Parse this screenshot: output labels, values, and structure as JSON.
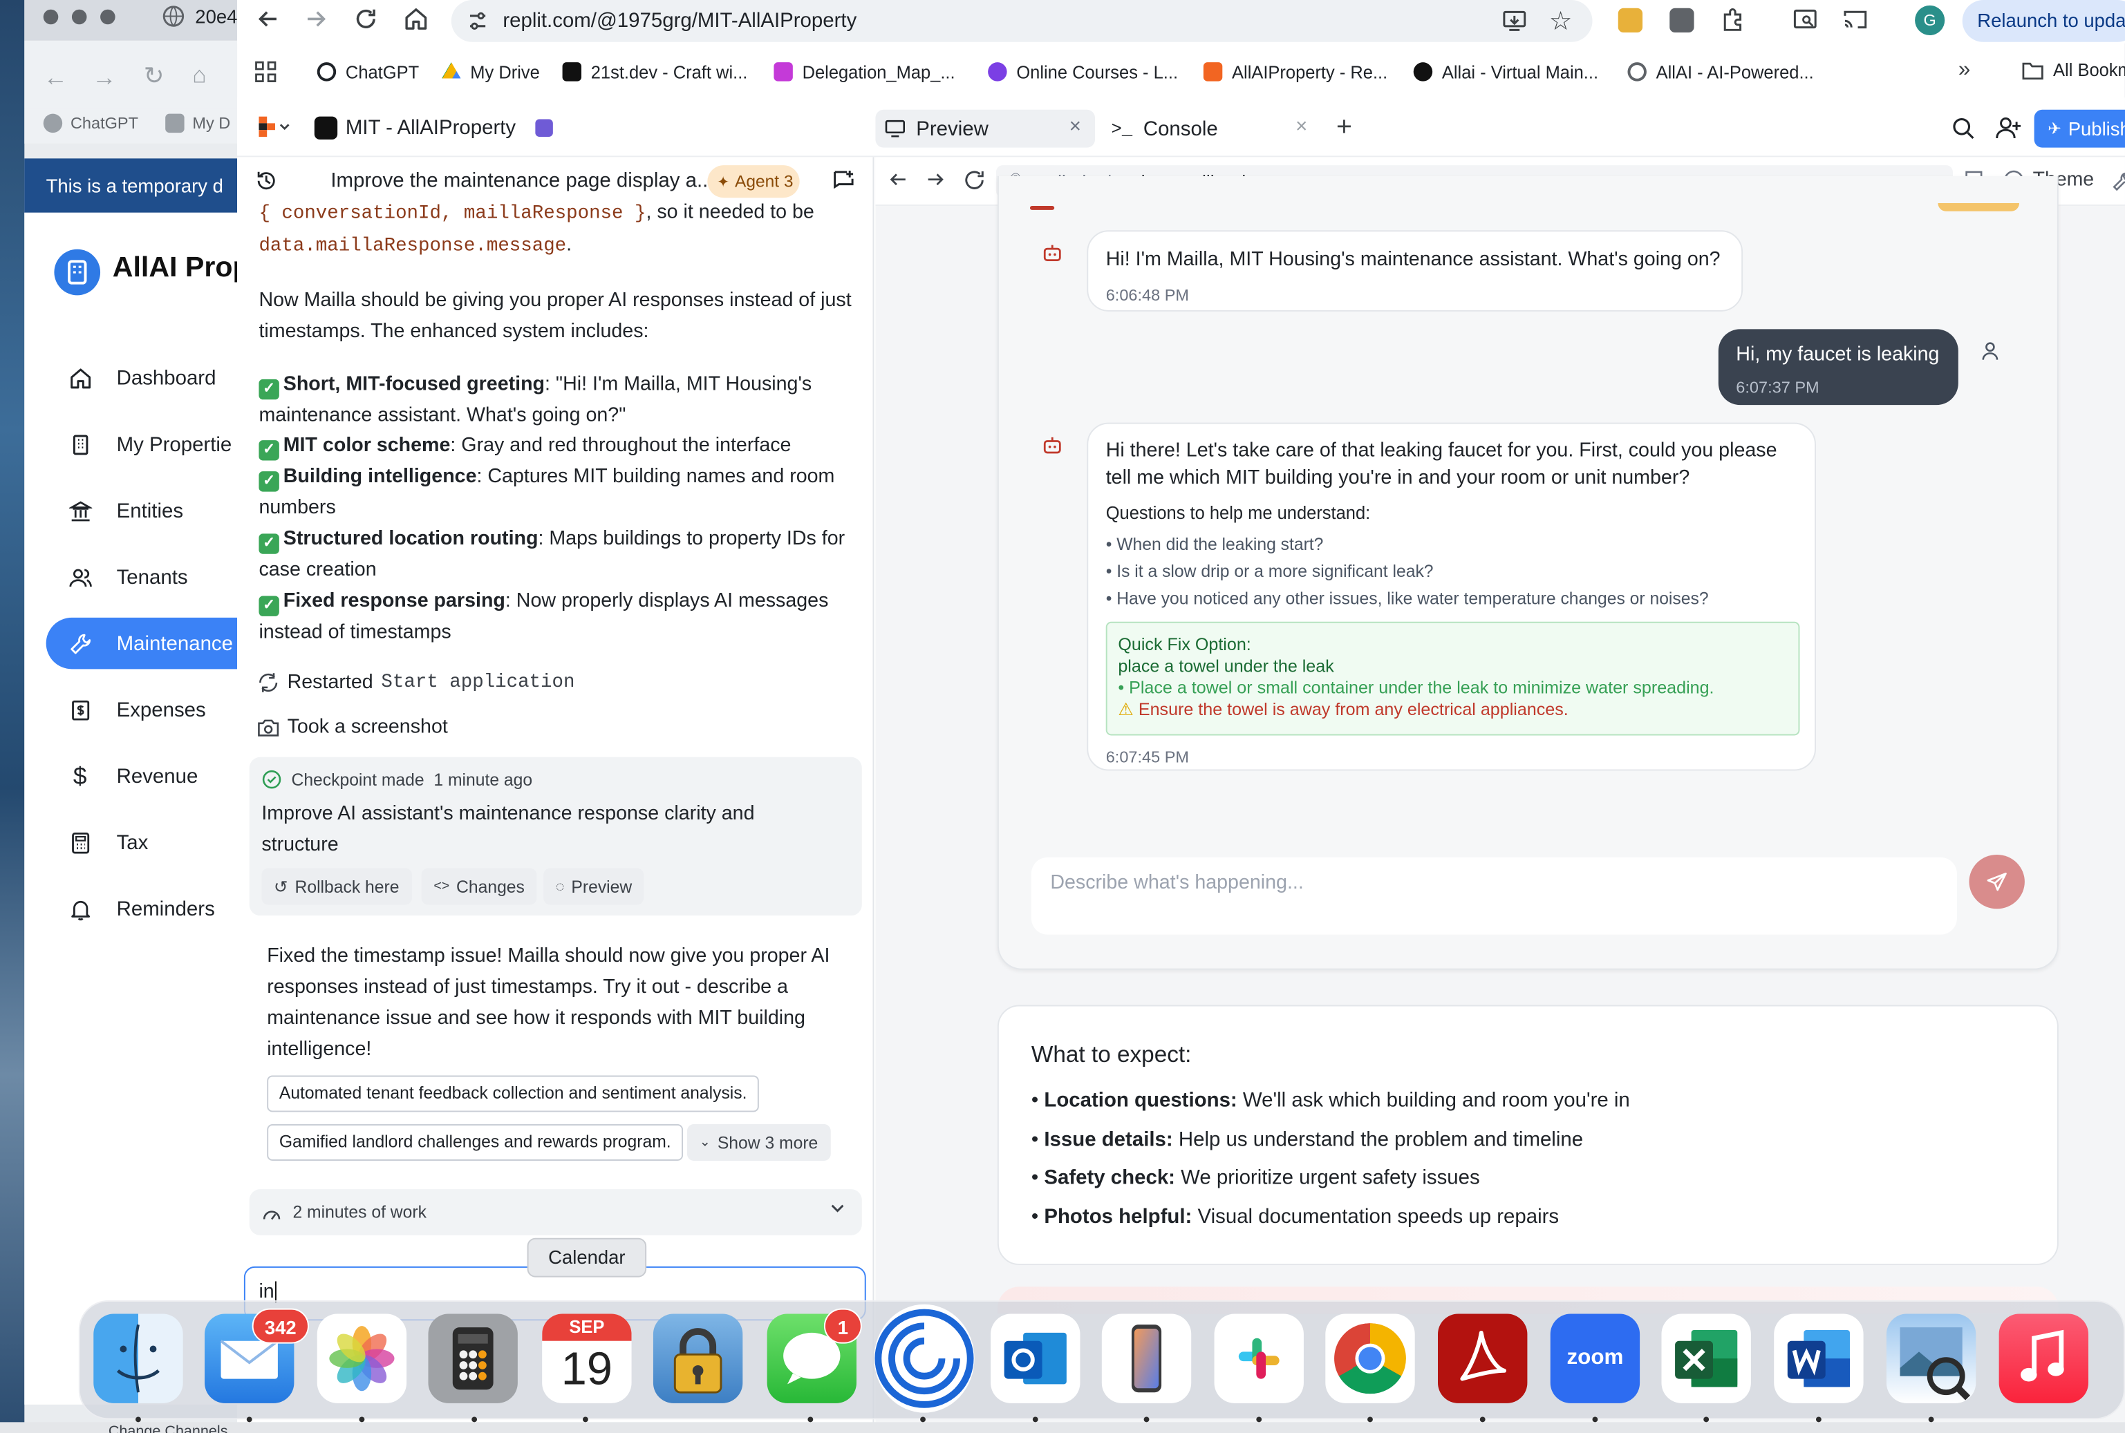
{
  "bg_window": {
    "tab_label": "20e4",
    "bookmarks": [
      "ChatGPT",
      "My D"
    ],
    "banner": "This is a temporary d",
    "app_title": "AllAI Prop",
    "nav": [
      {
        "label": "Dashboard",
        "icon": "home-icon"
      },
      {
        "label": "My Propertie",
        "icon": "building-icon"
      },
      {
        "label": "Entities",
        "icon": "columns-icon"
      },
      {
        "label": "Tenants",
        "icon": "users-icon"
      },
      {
        "label": "Maintenance",
        "icon": "wrench-icon",
        "active": true
      },
      {
        "label": "Expenses",
        "icon": "receipt-icon"
      },
      {
        "label": "Revenue",
        "icon": "dollar-icon"
      },
      {
        "label": "Tax",
        "icon": "calculator-icon"
      },
      {
        "label": "Reminders",
        "icon": "bell-icon"
      }
    ],
    "bottom_text": "Change Channels"
  },
  "browser": {
    "url": "replit.com/@1975grg/MIT-AllAIProperty",
    "relaunch": "Relaunch to upda",
    "bookmarks": [
      {
        "label": "ChatGPT",
        "color": "#1f2328"
      },
      {
        "label": "My Drive",
        "color": "#f4b400"
      },
      {
        "label": "21st.dev - Craft wi...",
        "color": "#111111"
      },
      {
        "label": "Delegation_Map_...",
        "color": "#c43ad8"
      },
      {
        "label": "Online Courses - L...",
        "color": "#7b3fe4"
      },
      {
        "label": "AllAIProperty - Re...",
        "color": "#f26522"
      },
      {
        "label": "Allai - Virtual Main...",
        "color": "#111111"
      },
      {
        "label": "AllAI - AI-Powered...",
        "color": "#5f6368"
      }
    ],
    "all_bookmarks": "All Bookm"
  },
  "replit": {
    "project": "MIT - AllAIProperty",
    "tabs": {
      "preview": "Preview",
      "console": "Console"
    },
    "publish": "Publish",
    "preview_url_prefix": ".replit.dev/",
    "preview_url_path": "student-mailla-triage",
    "theme": "Theme",
    "agent_badge": "Agent 3",
    "thread_title": "Improve the maintenance page display a...",
    "chat": {
      "code_line1": "{ conversationId, maillaResponse }",
      "text_line1_suffix": ", so it needed to be",
      "code_line2": "data.maillaResponse.message",
      "period": ".",
      "para1": "Now Mailla should be giving you proper AI responses instead of just timestamps. The enhanced system includes:",
      "features": [
        {
          "title": "Short, MIT-focused greeting",
          "text": ": \"Hi! I'm Mailla, MIT Housing's maintenance assistant. What's going on?\""
        },
        {
          "title": "MIT color scheme",
          "text": ": Gray and red throughout the interface"
        },
        {
          "title": "Building intelligence",
          "text": ": Captures MIT building names and room numbers"
        },
        {
          "title": "Structured location routing",
          "text": ": Maps buildings to property IDs for case creation"
        },
        {
          "title": "Fixed response parsing",
          "text": ": Now properly displays AI messages instead of timestamps"
        }
      ],
      "restarted_prefix": "Restarted",
      "restarted_code": "Start application",
      "screenshot": "Took a screenshot",
      "checkpoint_label": "Checkpoint made",
      "checkpoint_time": "1 minute ago",
      "checkpoint_title": "Improve AI assistant's maintenance response clarity and structure",
      "btn_rollback": "Rollback here",
      "btn_changes": "Changes",
      "btn_preview": "Preview",
      "final_msg": "Fixed the timestamp issue! Mailla should now give you proper AI responses instead of just timestamps. Try it out - describe a maintenance issue and see how it responds with MIT building intelligence!",
      "suggestion1": "Automated tenant feedback collection and sentiment analysis.",
      "suggestion2": "Gamified landlord challenges and rewards program.",
      "show_more": "Show 3 more",
      "work_time": "2 minutes of work",
      "input_value": "in"
    }
  },
  "preview": {
    "bot_greeting": "Hi! I'm Mailla, MIT Housing's maintenance assistant. What's going on?",
    "bot_greeting_time": "6:06:48 PM",
    "user_msg": "Hi, my faucet is leaking",
    "user_time": "6:07:37 PM",
    "bot_reply": "Hi there! Let's take care of that leaking faucet for you. First, could you please tell me which MIT building you're in and your room or unit number?",
    "questions_title": "Questions to help me understand:",
    "questions": [
      "• When did the leaking start?",
      "• Is it a slow drip or a more significant leak?",
      "• Have you noticed any other issues, like water temperature changes or noises?"
    ],
    "quick_fix_title": "Quick Fix Option:",
    "quick_fix_line1": "place a towel under the leak",
    "quick_fix_line2": "• Place a towel or small container under the leak to minimize water spreading.",
    "quick_fix_warning": "Ensure the towel is away from any electrical appliances.",
    "bot_reply_time": "6:07:45 PM",
    "input_placeholder": "Describe what's happening...",
    "expect_title": "What to expect:",
    "expect_items": [
      {
        "label": "Location questions:",
        "text": "We'll ask which building and room you're in"
      },
      {
        "label": "Issue details:",
        "text": "Help us understand the problem and timeline"
      },
      {
        "label": "Safety check:",
        "text": "We prioritize urgent safety issues"
      },
      {
        "label": "Photos helpful:",
        "text": "Visual documentation speeds up repairs"
      }
    ]
  },
  "dock": {
    "tooltip": "Calendar",
    "mail_badge": "342",
    "messages_badge": "1",
    "calendar_month": "SEP",
    "calendar_day": "19",
    "zoom_label": "zoom",
    "apps": [
      "finder-icon",
      "mail-icon",
      "photos-icon",
      "calculator-icon",
      "calendar-icon",
      "keychain-icon",
      "messages-icon",
      "copilot-icon",
      "outlook-icon",
      "iphone-mirroring-icon",
      "slack-icon",
      "chrome-icon",
      "acrobat-icon",
      "zoom-icon",
      "excel-icon",
      "word-icon",
      "preview-icon",
      "music-icon"
    ]
  },
  "colors": {
    "accent": "#3b82f6",
    "bot_red": "#c0392b",
    "user_bubble": "#3a4350",
    "send_button": "#d98c8c"
  }
}
